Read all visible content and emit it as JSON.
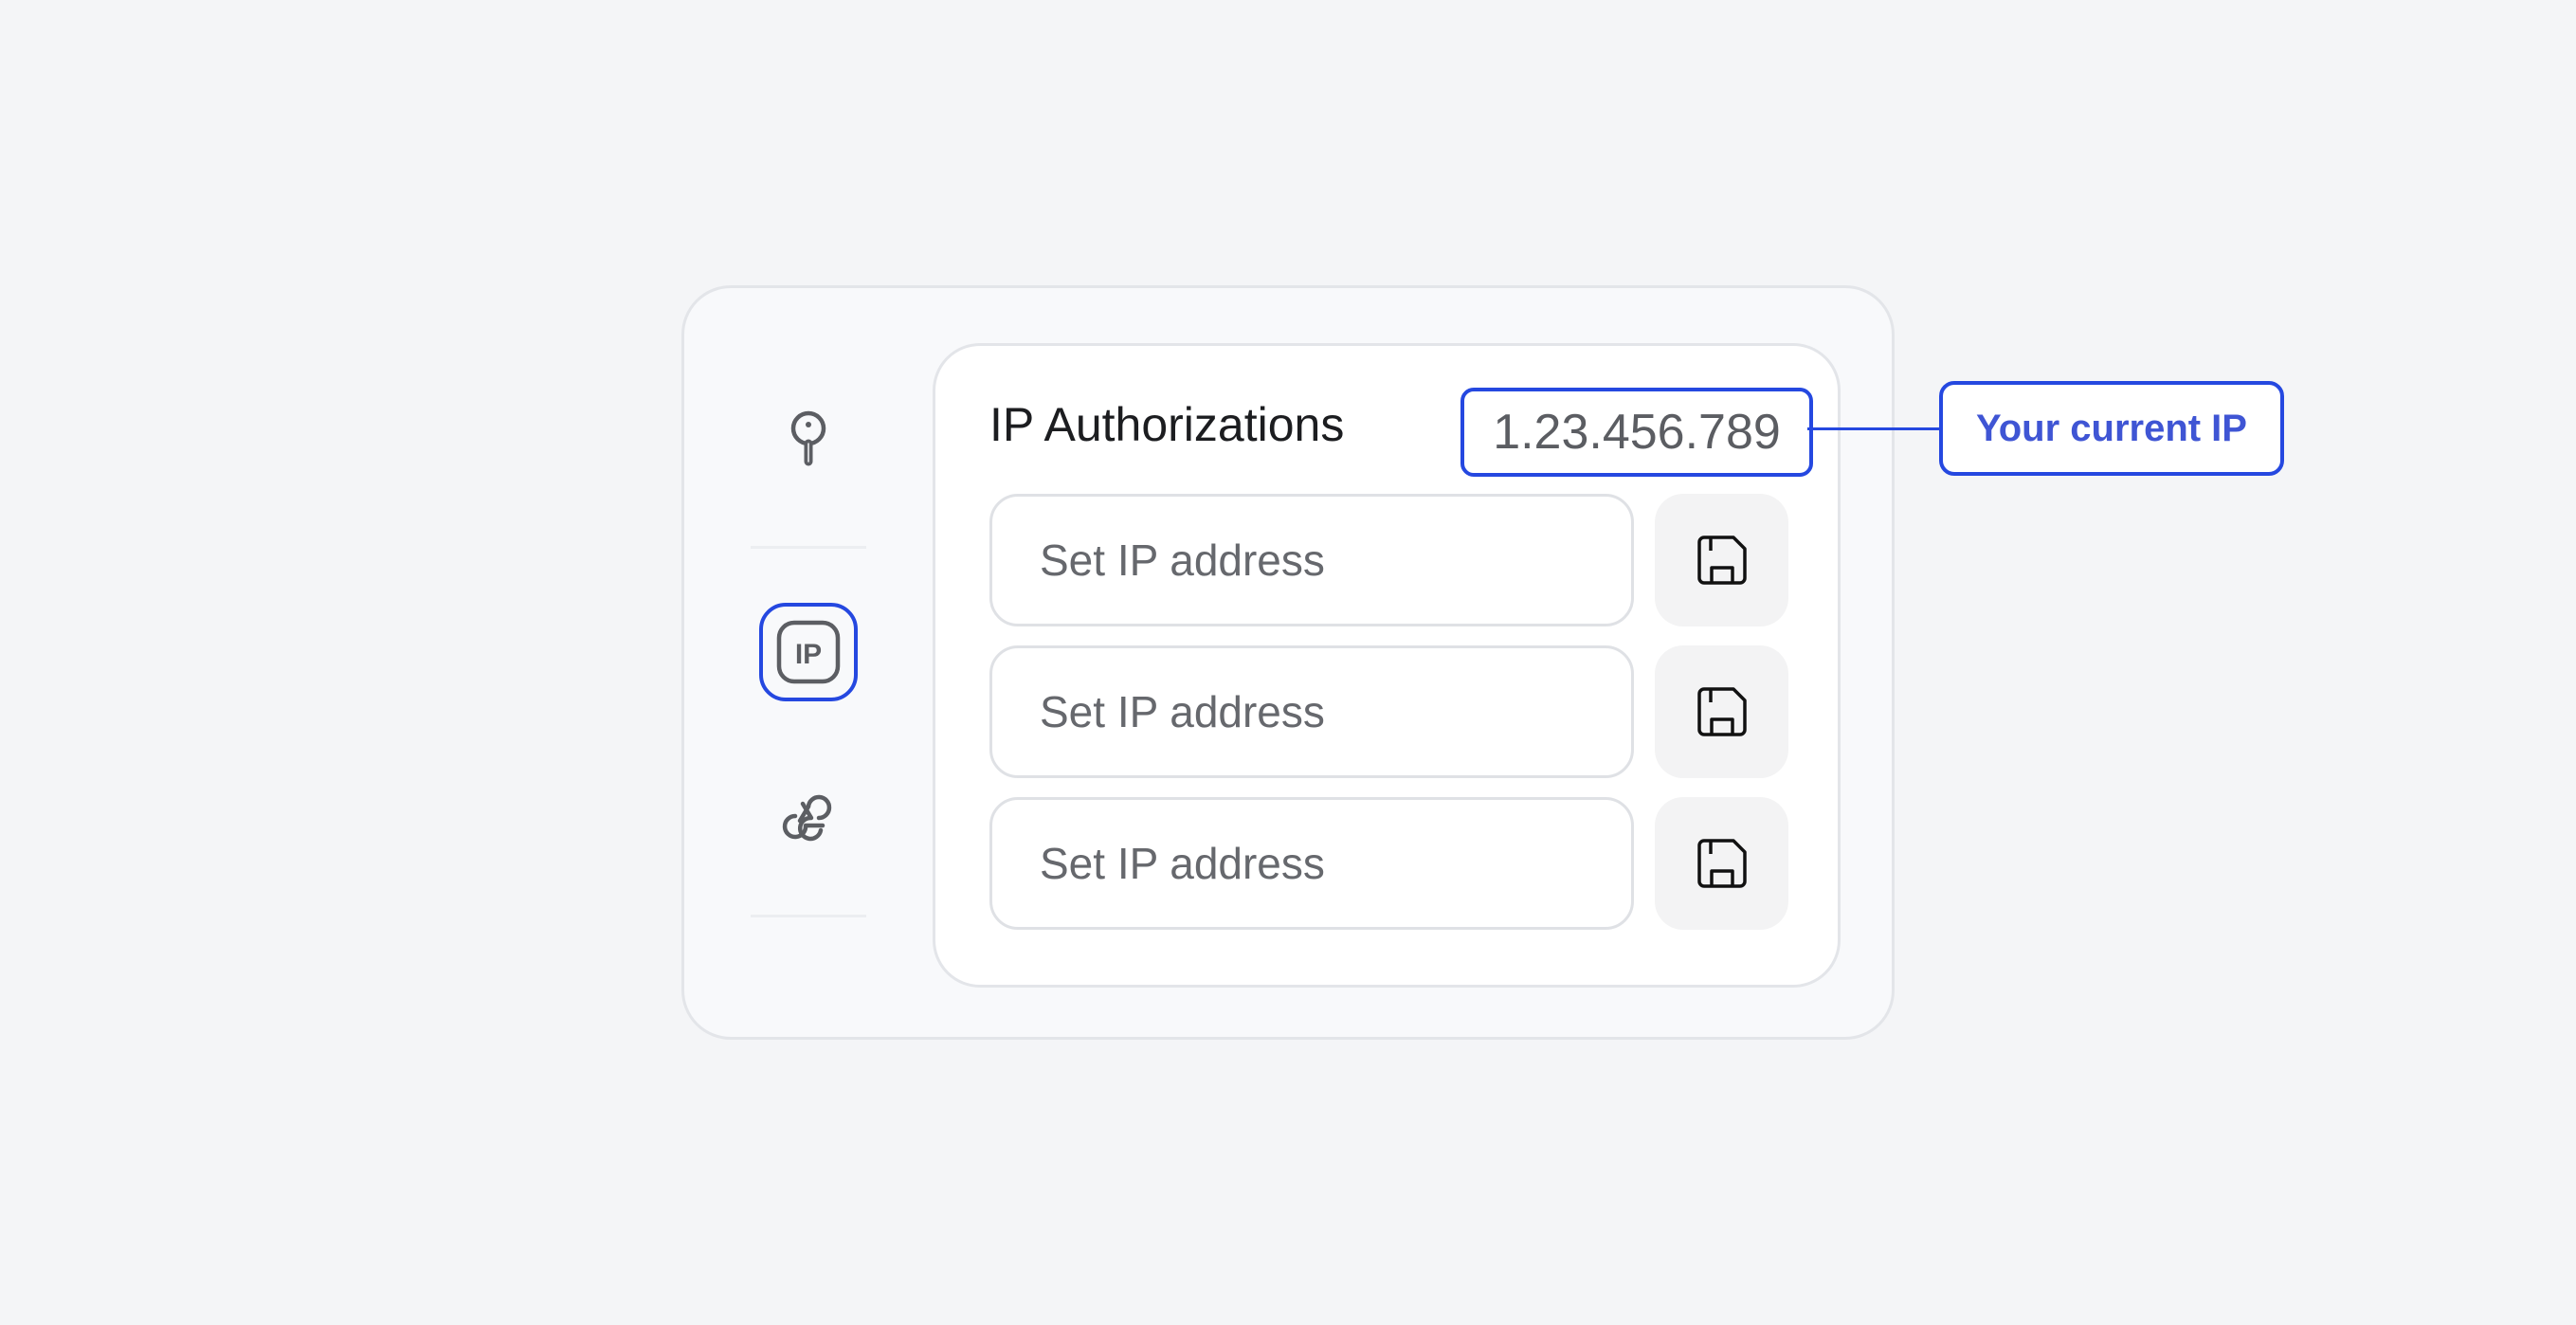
{
  "panel": {
    "title": "IP Authorizations",
    "current_ip": "1.23.456.789"
  },
  "sidebar": {
    "items": [
      {
        "icon": "key-icon",
        "active": false
      },
      {
        "icon": "ip-icon",
        "label": "IP",
        "active": true
      },
      {
        "icon": "webhook-icon",
        "active": false
      }
    ]
  },
  "ip_rows": [
    {
      "placeholder": "Set IP address",
      "value": ""
    },
    {
      "placeholder": "Set IP address",
      "value": ""
    },
    {
      "placeholder": "Set IP address",
      "value": ""
    }
  ],
  "callout": {
    "label": "Your current IP"
  },
  "colors": {
    "accent": "#2548e0",
    "callout_text": "#3f55d4",
    "icon": "#5c5e63",
    "save_icon": "#111111"
  }
}
